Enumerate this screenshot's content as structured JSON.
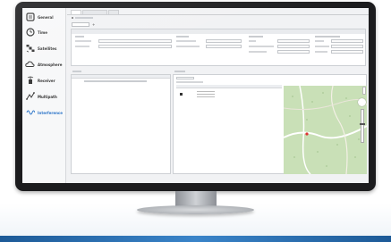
{
  "sidebar": {
    "items": [
      {
        "label": "General",
        "icon": "general-icon",
        "active": false
      },
      {
        "label": "Time",
        "icon": "clock-icon",
        "active": false
      },
      {
        "label": "Satellites",
        "icon": "satellite-icon",
        "active": false
      },
      {
        "label": "Atmosphere",
        "icon": "cloud-icon",
        "active": false
      },
      {
        "label": "Receiver",
        "icon": "receiver-icon",
        "active": false
      },
      {
        "label": "Multipath",
        "icon": "multipath-icon",
        "active": false
      },
      {
        "label": "Interference",
        "icon": "interference-icon",
        "active": true
      }
    ]
  },
  "colors": {
    "accent": "#2b74c9",
    "map_green": "#c8e0b8",
    "map_road": "#ffffff",
    "frame": "#1c1c1e"
  }
}
